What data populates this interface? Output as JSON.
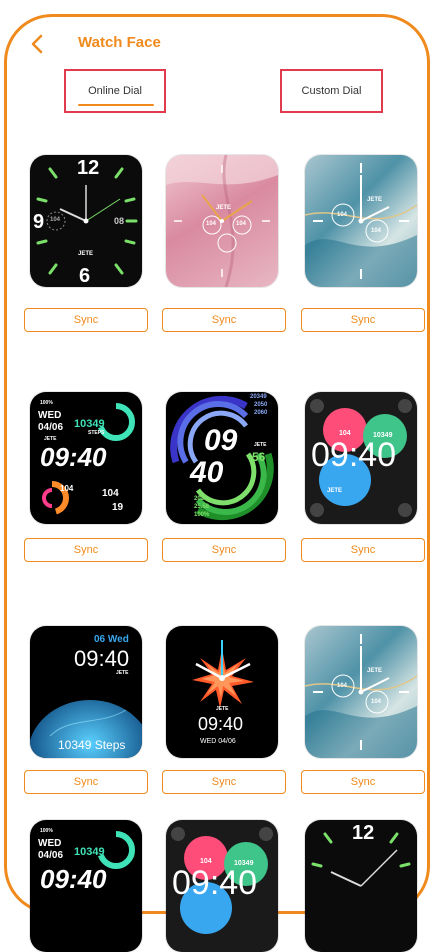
{
  "header": {
    "title": "Watch Face",
    "back_icon": "chevron-left-icon"
  },
  "tabs": [
    {
      "label": "Online Dial",
      "active": true
    },
    {
      "label": "Custom Dial",
      "active": false
    }
  ],
  "sync_label": "Sync",
  "colors": {
    "accent": "#F08A1C",
    "tab_border": "#E33B4E"
  },
  "dials": {
    "d1": {
      "top": "12",
      "left": "9",
      "bottom": "6",
      "date": "08",
      "brand": "JETE",
      "pulse": "104"
    },
    "d2": {
      "brand": "JETE",
      "val1": "104",
      "val2": "104"
    },
    "d3": {
      "brand": "JETE",
      "val1": "104",
      "val2": "104"
    },
    "d4": {
      "battery": "100%",
      "day": "WED",
      "date": "04/06",
      "steps": "10349",
      "steps_label": "STEPS",
      "brand": "JETE",
      "time": "09:40",
      "heart": "104",
      "cal": "104",
      "dist": "19"
    },
    "d5": {
      "hour": "09",
      "minute": "40",
      "brand": "JETE",
      "sec": "56",
      "top1": "20349",
      "top2": "2050",
      "top3": "2060",
      "bot1": "2020",
      "bot2": "25.58",
      "bot3": "100%"
    },
    "d6": {
      "time": "09:40",
      "heart": "104",
      "steps": "10349",
      "brand": "JETE"
    },
    "d7": {
      "date": "06 Wed",
      "time": "09:40",
      "brand": "JETE",
      "steps": "10349 Steps"
    },
    "d8": {
      "brand": "JETE",
      "time": "09:40",
      "date": "WED 04/06"
    },
    "d9": {
      "brand": "JETE",
      "val1": "104",
      "val2": "104"
    },
    "d10": {
      "battery": "100%",
      "day": "WED",
      "date": "04/06",
      "steps": "10349",
      "time": "09:40"
    },
    "d11": {
      "heart": "104",
      "steps": "10349",
      "time": "09:40"
    },
    "d12": {
      "top": "12"
    }
  }
}
